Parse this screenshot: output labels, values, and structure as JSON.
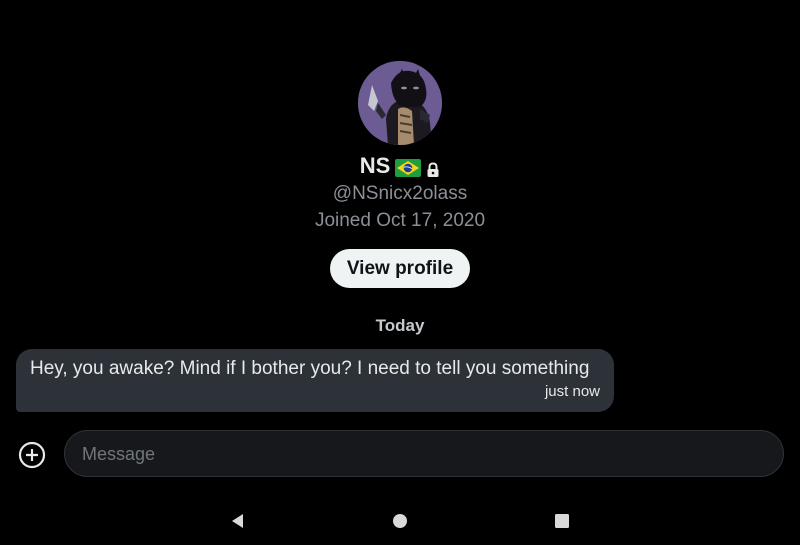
{
  "profile": {
    "name": "NS",
    "flag_icon": "brazil-flag-icon",
    "lock_icon": "lock-icon",
    "handle": "@NSnicx2olass",
    "joined": "Joined Oct 17, 2020",
    "view_profile_label": "View profile"
  },
  "conversation": {
    "day_label": "Today",
    "messages": [
      {
        "text": "Hey, you awake? Mind if I bother you? I need to tell you something",
        "time": "just now"
      }
    ]
  },
  "composer": {
    "add_icon": "add-circle-icon",
    "placeholder": "Message",
    "value": ""
  },
  "system_nav": {
    "back_icon": "back-triangle-icon",
    "home_icon": "home-circle-icon",
    "recents_icon": "recents-square-icon"
  },
  "colors": {
    "background": "#000000",
    "bubble": "#2c3238",
    "button_bg": "#eff3f4",
    "muted_text": "#8b9096",
    "avatar_bg": "#6b5a8e"
  }
}
